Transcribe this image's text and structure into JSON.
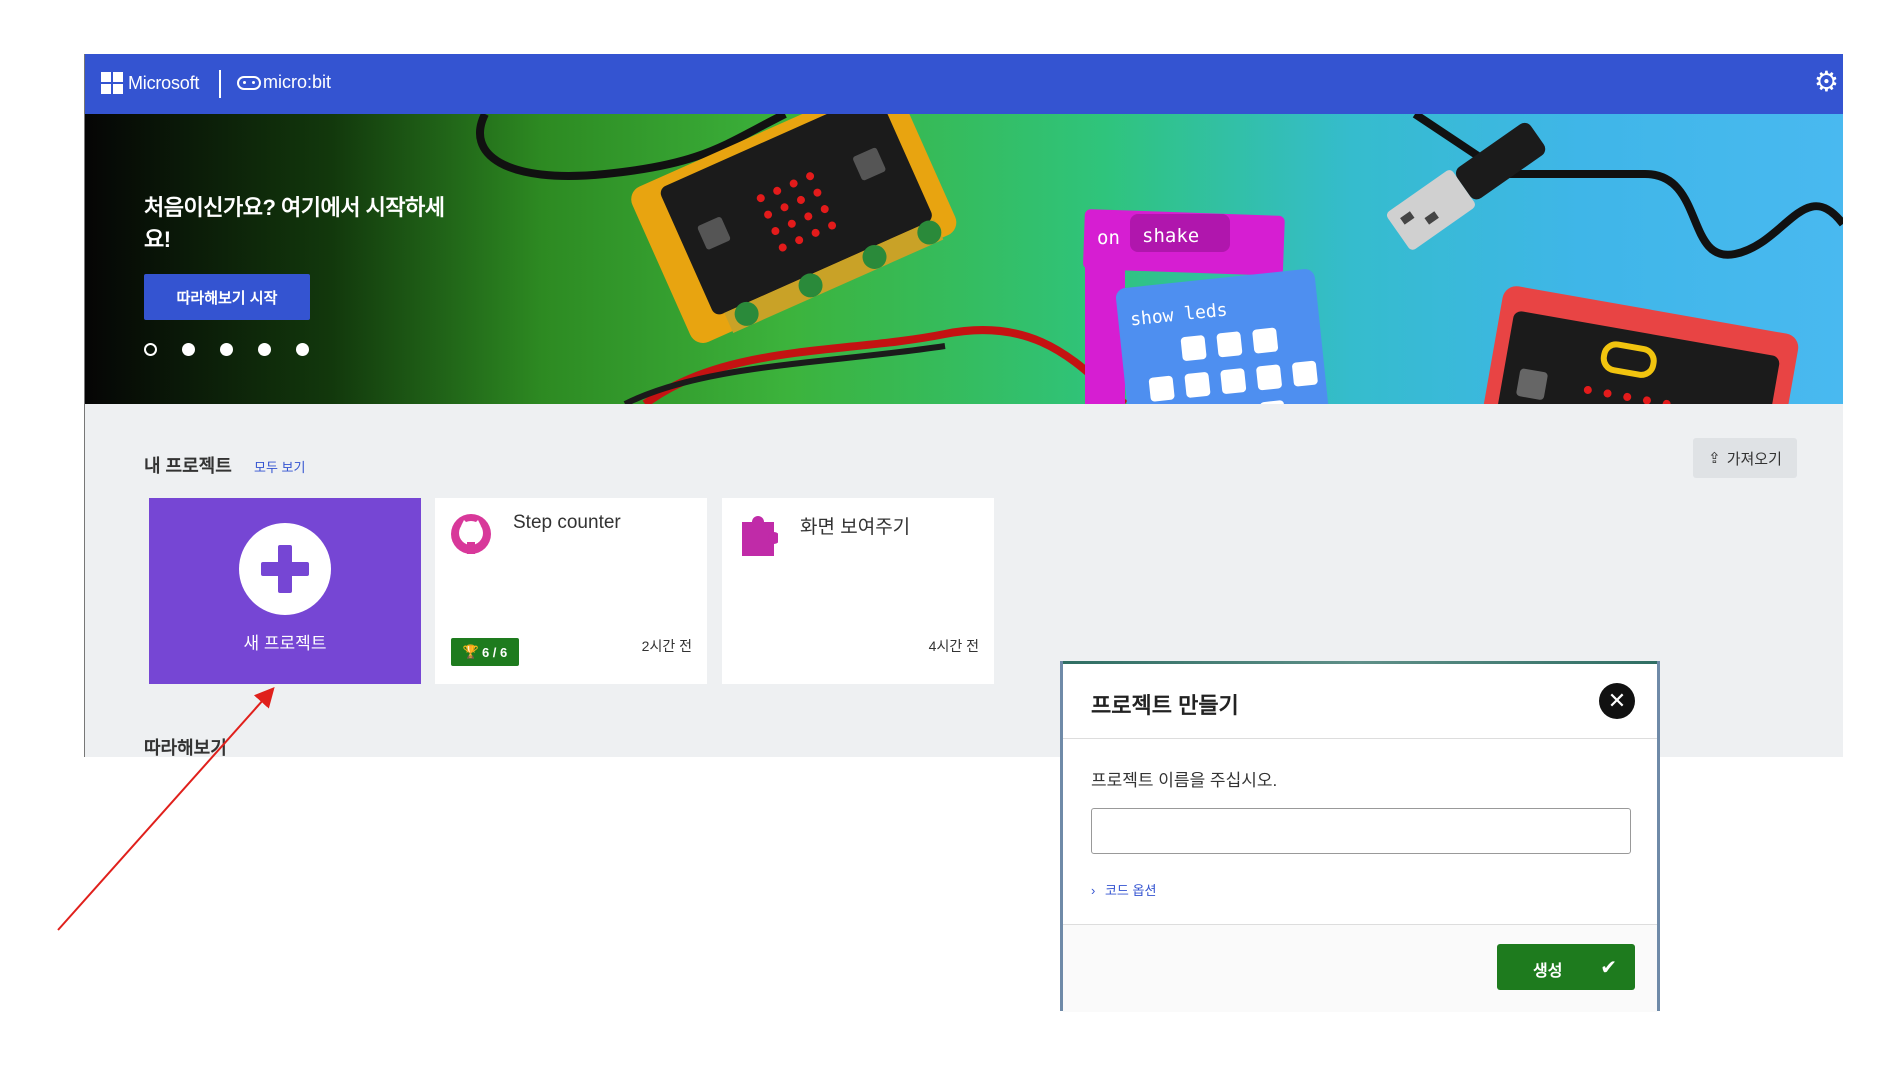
{
  "header": {
    "brand": "Microsoft",
    "product": "micro:bit"
  },
  "hero": {
    "title": "처음이신가요? 여기에서 시작하세요!",
    "button_label": "따라해보기 시작",
    "slide_count": 5,
    "active_slide": 1,
    "art_labels": {
      "on": "on",
      "shake": "shake",
      "show_leds": "show leds"
    }
  },
  "projects": {
    "title": "내 프로젝트",
    "see_all": "모두 보기",
    "import_label": "가져오기",
    "new_label": "새 프로젝트",
    "items": [
      {
        "title": "Step counter",
        "time": "2시간 전",
        "badge": "6 / 6",
        "icon": "github-icon"
      },
      {
        "title": "화면 보여주기",
        "time": "4시간 전",
        "icon": "puzzle-icon"
      }
    ]
  },
  "tutorials": {
    "title": "따라해보기"
  },
  "dialog": {
    "title": "프로젝트 만들기",
    "prompt": "프로젝트 이름을 주십시오.",
    "input_value": "",
    "options_label": "코드 옵션",
    "create_label": "생성"
  },
  "colors": {
    "header": "#3454d1",
    "new_project": "#7646d4",
    "create": "#1e7b1e",
    "annotation_arrow": "#e0201c"
  }
}
